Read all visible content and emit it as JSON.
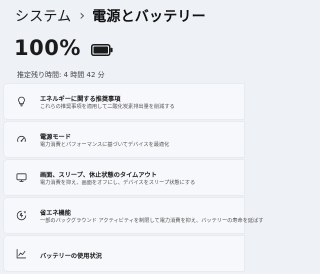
{
  "breadcrumb": {
    "parent": "システム",
    "separator": "›",
    "current": "電源とバッテリー"
  },
  "battery": {
    "percent_label": "100%",
    "level": 1.0,
    "remaining": "推定残り時間: 4 時間 42 分"
  },
  "items": [
    {
      "icon": "lightbulb-icon",
      "title": "エネルギーに関する推奨事項",
      "desc": "これらの推奨事項を適用して二酸化炭素排出量を削減する"
    },
    {
      "icon": "power-mode-icon",
      "title": "電源モード",
      "desc": "電力消費とパフォーマンスに基づいてデバイスを最適化"
    },
    {
      "icon": "monitor-icon",
      "title": "画面、スリープ、休止状態のタイムアウト",
      "desc": "電力消費を抑え、画面をオフにし、デバイスをスリープ状態にする"
    },
    {
      "icon": "battery-saver-icon",
      "title": "省エネ機能",
      "desc": "一部のバックグラウンド アクティビティを制限して電力消費を抑え、バッテリーの寿命を延ばす"
    },
    {
      "icon": "usage-chart-icon",
      "title": "バッテリーの使用状況",
      "desc": ""
    }
  ],
  "colors": {
    "background": "#eef1f6",
    "card": "#f7f8fb",
    "text": "#1b1b1b"
  }
}
